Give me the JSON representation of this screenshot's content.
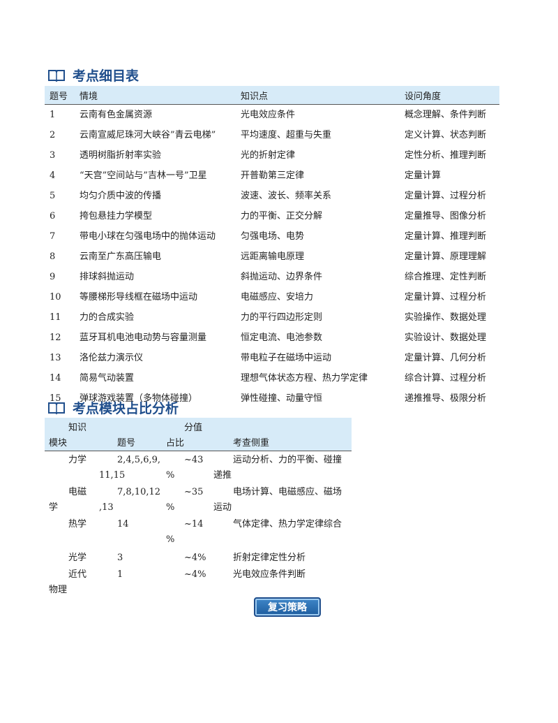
{
  "section1": {
    "title": "考点细目表",
    "headers": [
      "题号",
      "情境",
      "知识点",
      "设问角度"
    ],
    "rows": [
      [
        "1",
        "云南有色金属资源",
        "光电效应条件",
        "概念理解、条件判断"
      ],
      [
        "2",
        "云南宣威尼珠河大峡谷”青云电梯”",
        "平均速度、超重与失重",
        "定义计算、状态判断"
      ],
      [
        "3",
        "透明树脂折射率实验",
        "光的折射定律",
        "定性分析、推理判断"
      ],
      [
        "4",
        "“天宫”空间站与”吉林一号”卫星",
        "开普勒第三定律",
        "定量计算"
      ],
      [
        "5",
        "均匀介质中波的传播",
        "波速、波长、频率关系",
        "定量计算、过程分析"
      ],
      [
        "6",
        "挎包悬挂力学模型",
        "力的平衡、正交分解",
        "定量推导、图像分析"
      ],
      [
        "7",
        "带电小球在匀强电场中的抛体运动",
        "匀强电场、电势",
        "定量计算、推理判断"
      ],
      [
        "8",
        "云南至广东高压输电",
        "远距离输电原理",
        "定量计算、原理理解"
      ],
      [
        "9",
        "排球斜抛运动",
        "斜抛运动、边界条件",
        "综合推理、定性判断"
      ],
      [
        "10",
        "等腰梯形导线框在磁场中运动",
        "电磁感应、安培力",
        "定量计算、过程分析"
      ],
      [
        "11",
        "力的合成实验",
        "力的平行四边形定则",
        "实验操作、数据处理"
      ],
      [
        "12",
        "蓝牙耳机电池电动势与容量测量",
        "恒定电流、电池参数",
        "实验设计、数据处理"
      ],
      [
        "13",
        "洛伦兹力演示仪",
        "带电粒子在磁场中运动",
        "定量计算、几何分析"
      ],
      [
        "14",
        "简易气动装置",
        "理想气体状态方程、热力学定律",
        "综合计算、过程分析"
      ],
      [
        "15",
        "弹球游戏装置（多物体碰撞）",
        "弹性碰撞、动量守恒",
        "递推推导、极限分析"
      ]
    ]
  },
  "section2": {
    "title": "考点模块占比分析",
    "header": {
      "zhishi": "知识",
      "mokuai": "模块",
      "tihao": "题号",
      "fenzhi": "分值",
      "zhanbi": "占比",
      "kaocha": "考查侧重"
    },
    "rows": [
      {
        "module_a": "力学",
        "module_b": "",
        "nums_a": "2,4,5,6,9,",
        "nums_b": "11,15",
        "pct_a": "~43",
        "pct_b": "%",
        "focus_a": "运动分析、力的平衡、碰撞",
        "focus_b": "递推"
      },
      {
        "module_a": "电磁",
        "module_b": "学",
        "nums_a": "7,8,10,12",
        "nums_b": ",13",
        "pct_a": "~35",
        "pct_b": "%",
        "focus_a": "电场计算、电磁感应、磁场",
        "focus_b": "运动"
      },
      {
        "module_a": "热学",
        "module_b": "",
        "nums_a": "14",
        "nums_b": "",
        "pct_a": "~14",
        "pct_b": "%",
        "focus_a": "气体定律、热力学定律综合",
        "focus_b": ""
      },
      {
        "module_a": "光学",
        "module_b": "",
        "nums_a": "3",
        "nums_b": "",
        "pct_a": "~4%",
        "pct_b": "",
        "focus_a": "折射定律定性分析",
        "focus_b": ""
      },
      {
        "module_a": "近代",
        "module_b": "物理",
        "nums_a": "1",
        "nums_b": "",
        "pct_a": "~4%",
        "pct_b": "",
        "focus_a": "光电效应条件判断",
        "focus_b": ""
      }
    ]
  },
  "button": {
    "label": "复习策略"
  },
  "colors": {
    "accent": "#1f4e8c",
    "header_bg": "#d7ebf8"
  },
  "icons": {
    "section": "book-icon"
  }
}
